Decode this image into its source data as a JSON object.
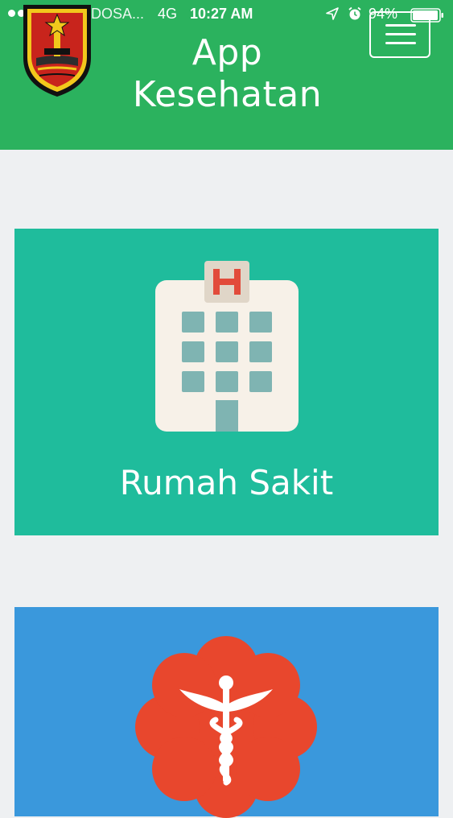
{
  "status_bar": {
    "carrier": "IM3 INDOSA...",
    "network": "4G",
    "time": "10:27 AM",
    "battery": "94%"
  },
  "header": {
    "title_line1": "App",
    "title_line2": "Kesehatan",
    "logo": "city-crest-logo",
    "menu_icon": "hamburger-menu-icon"
  },
  "cards": [
    {
      "label": "Rumah Sakit",
      "icon": "hospital-building-icon",
      "color": "#1fbc9c"
    },
    {
      "label": "",
      "icon": "medical-caduceus-icon",
      "color": "#3a98dc"
    }
  ],
  "colors": {
    "header_green": "#2bb25e",
    "background": "#eef0f2",
    "hospital_teal": "#1fbc9c",
    "second_blue": "#3a98dc",
    "medical_red": "#e8472d"
  }
}
